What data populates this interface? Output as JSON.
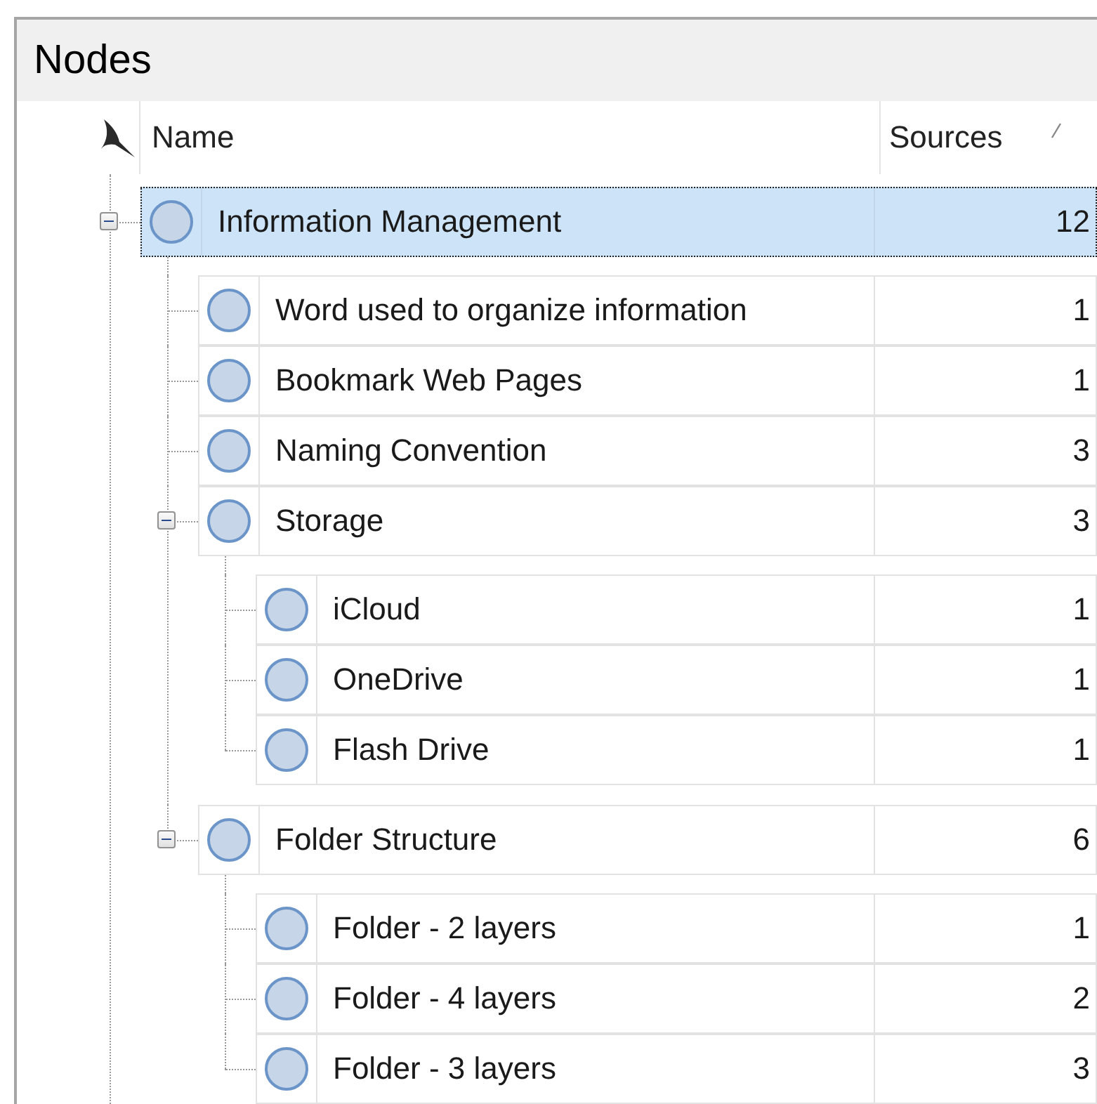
{
  "panel": {
    "title": "Nodes"
  },
  "columns": [
    {
      "label": "Name",
      "sorted": false
    },
    {
      "label": "Sources",
      "sorted": true
    }
  ],
  "nodes": [
    {
      "name": "Information Management",
      "sources": "12",
      "selected": true,
      "expanded": true,
      "children": [
        {
          "name": "Word used to organize information",
          "sources": "1",
          "selected": false
        },
        {
          "name": "Bookmark Web Pages",
          "sources": "1",
          "selected": false
        },
        {
          "name": "Naming Convention",
          "sources": "3",
          "selected": false
        },
        {
          "name": "Storage",
          "sources": "3",
          "selected": false,
          "expanded": true,
          "children": [
            {
              "name": "iCloud",
              "sources": "1",
              "selected": false
            },
            {
              "name": "OneDrive",
              "sources": "1",
              "selected": false
            },
            {
              "name": "Flash Drive",
              "sources": "1",
              "selected": false
            }
          ]
        },
        {
          "name": "Folder Structure",
          "sources": "6",
          "selected": false,
          "expanded": true,
          "children": [
            {
              "name": "Folder - 2 layers",
              "sources": "1",
              "selected": false
            },
            {
              "name": "Folder - 4 layers",
              "sources": "2",
              "selected": false
            },
            {
              "name": "Folder - 3 layers",
              "sources": "3",
              "selected": false
            }
          ]
        }
      ]
    }
  ]
}
